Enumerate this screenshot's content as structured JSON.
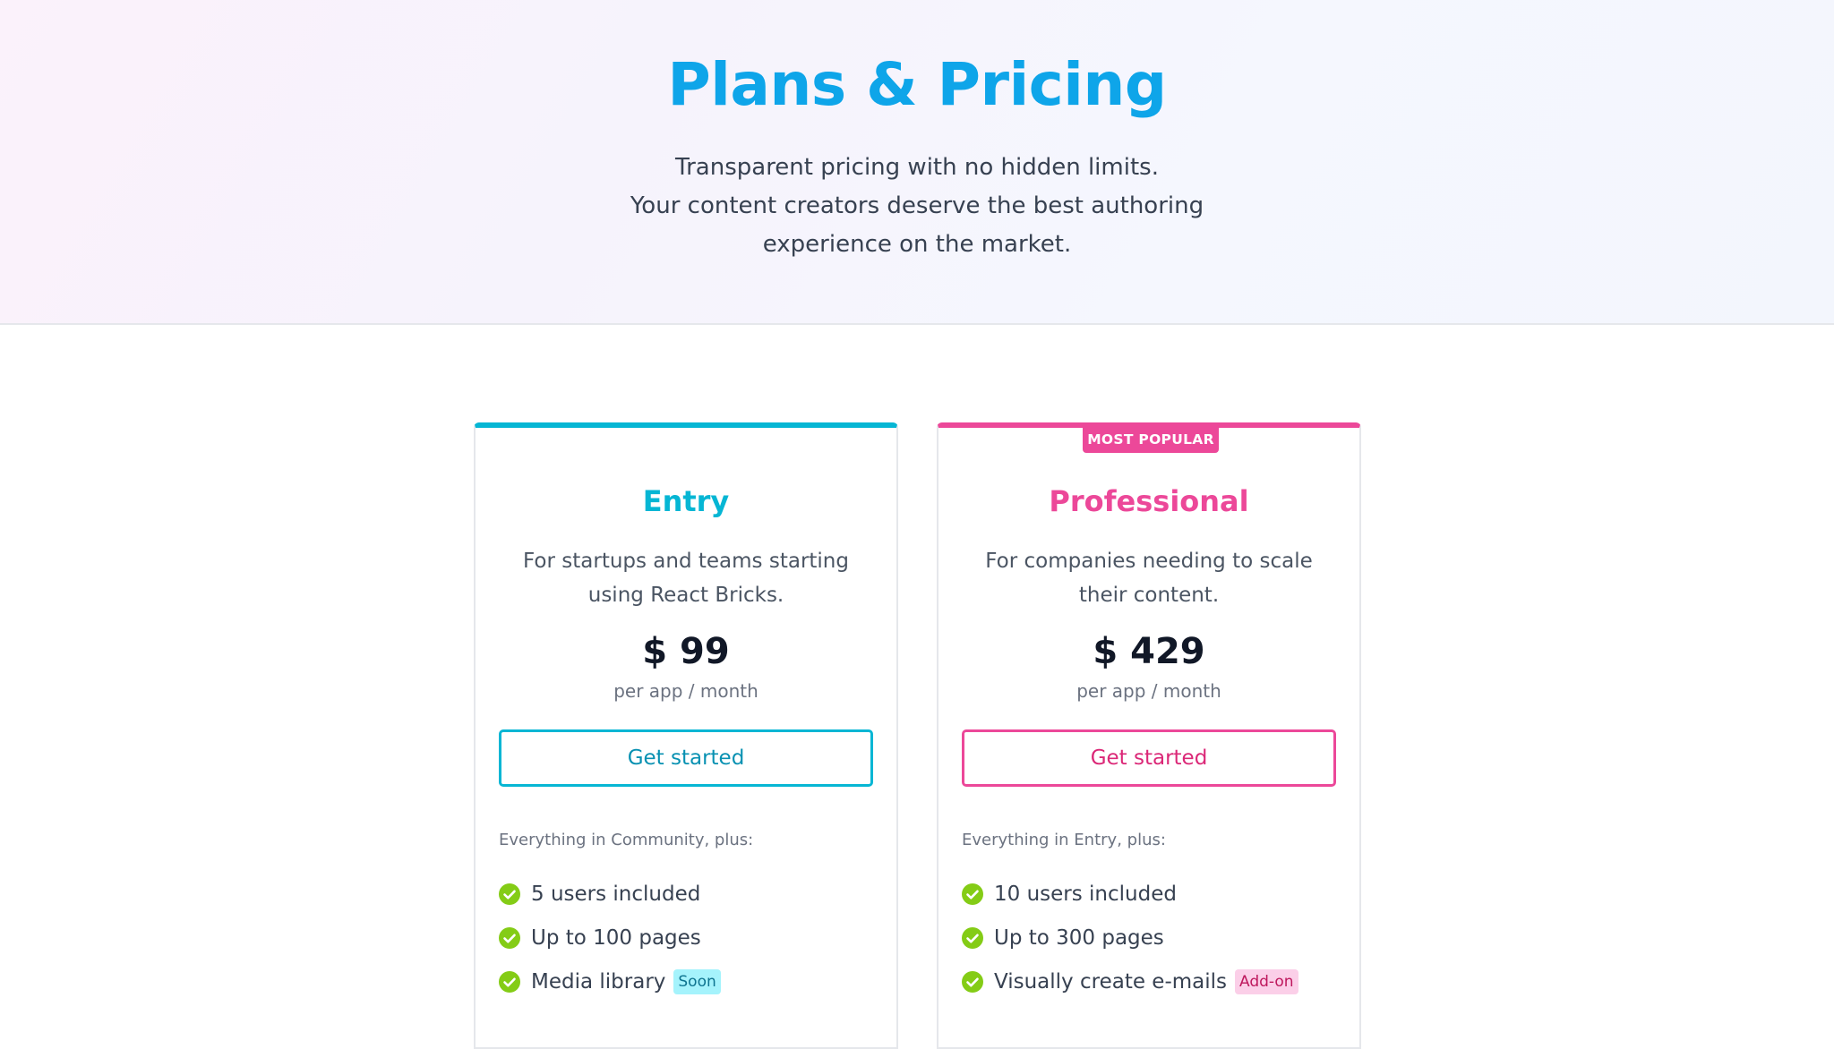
{
  "hero": {
    "title": "Plans & Pricing",
    "subtitle_lines": [
      "Transparent pricing with no hidden limits.",
      "Your content creators deserve the best authoring",
      "experience on the market."
    ]
  },
  "plans": [
    {
      "name": "Entry",
      "accent": "#06b6d4",
      "description": "For startups and teams starting using React Bricks.",
      "price": "$ 99",
      "period": "per app / month",
      "cta_label": "Get started",
      "features_intro": "Everything in Community, plus:",
      "features": [
        {
          "label": "5 users included",
          "tag": ""
        },
        {
          "label": "Up to 100 pages",
          "tag": ""
        },
        {
          "label": "Media library",
          "tag": "Soon"
        }
      ]
    },
    {
      "name": "Professional",
      "accent": "#ec4899",
      "badge": "MOST POPULAR",
      "description": "For companies needing to scale their content.",
      "price": "$ 429",
      "period": "per app / month",
      "cta_label": "Get started",
      "features_intro": "Everything in Entry, plus:",
      "features": [
        {
          "label": "10 users included",
          "tag": ""
        },
        {
          "label": "Up to 300 pages",
          "tag": ""
        },
        {
          "label": "Visually create e-mails",
          "tag": "Add-on"
        }
      ]
    }
  ],
  "icons": {
    "feature_check": "check-circle-icon",
    "check_color": "#84cc16"
  }
}
